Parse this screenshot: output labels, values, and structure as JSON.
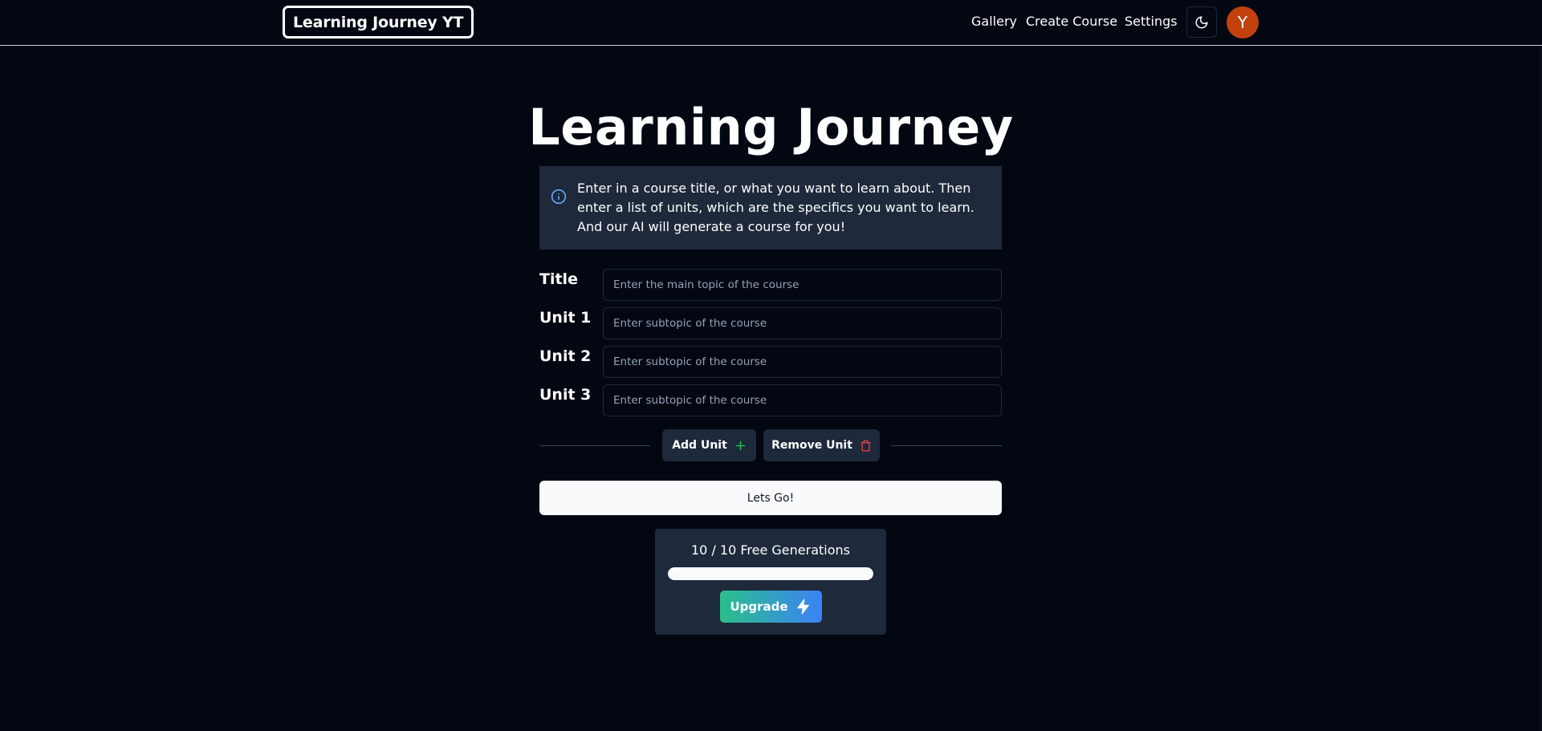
{
  "navbar": {
    "logo": "Learning Journey YT",
    "links": [
      "Gallery",
      "Create Course",
      "Settings"
    ],
    "avatar_initial": "Y"
  },
  "main": {
    "title": "Learning Journey",
    "info": "Enter in a course title, or what you want to learn about. Then enter a list of units, which are the specifics you want to learn. And our AI will generate a course for you!",
    "form": {
      "rows": [
        {
          "label": "Title",
          "value": "",
          "placeholder": "Enter the main topic of the course"
        },
        {
          "label": "Unit 1",
          "value": "",
          "placeholder": "Enter subtopic of the course"
        },
        {
          "label": "Unit 2",
          "value": "",
          "placeholder": "Enter subtopic of the course"
        },
        {
          "label": "Unit 3",
          "value": "",
          "placeholder": "Enter subtopic of the course"
        }
      ],
      "add_unit_label": "Add Unit",
      "remove_unit_label": "Remove Unit",
      "submit_label": "Lets Go!"
    },
    "generations": {
      "text": "10 / 10 Free Generations",
      "progress_fraction": 1.0,
      "upgrade_label": "Upgrade"
    }
  },
  "colors": {
    "background": "#030712",
    "card": "#1e293b",
    "avatar": "#c2410c",
    "add_icon": "#22c55e",
    "remove_icon": "#ef4444",
    "upgrade_gradient_start": "#2bbf8a",
    "upgrade_gradient_end": "#3b82f6"
  },
  "icons": {
    "theme_toggle": "moon-icon",
    "info": "info-icon",
    "add": "plus-icon",
    "remove": "trash-icon",
    "upgrade": "lightning-icon"
  }
}
